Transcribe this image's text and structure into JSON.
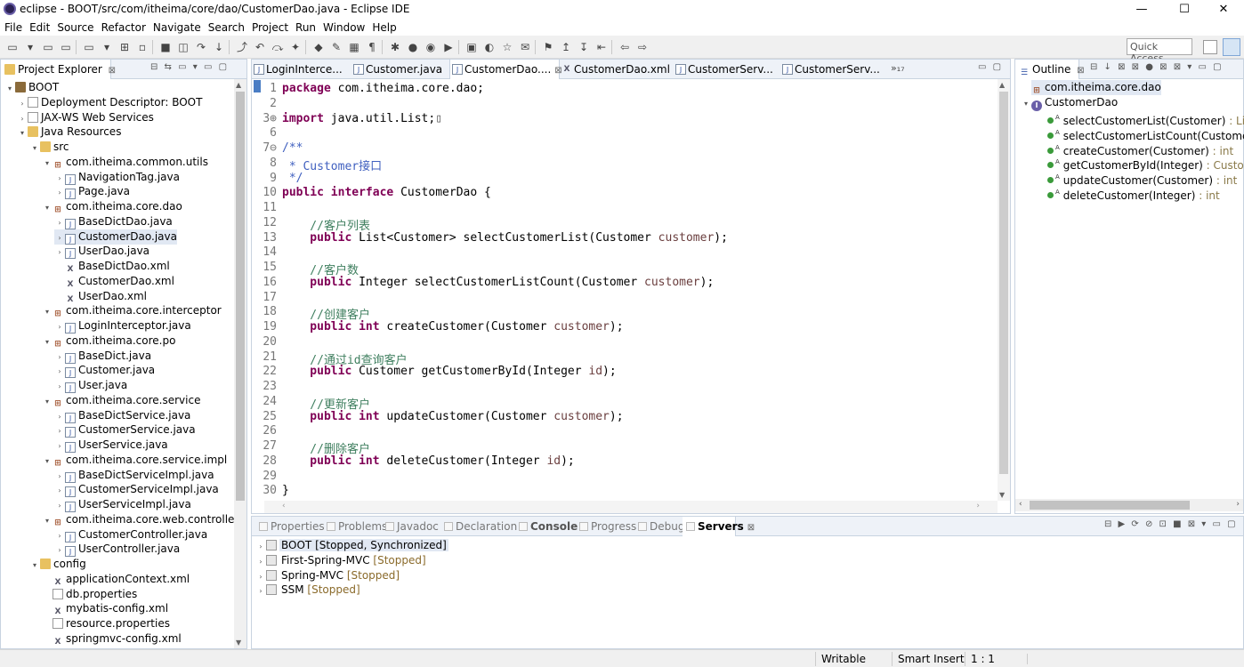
{
  "window": {
    "title": "eclipse - BOOT/src/com/itheima/core/dao/CustomerDao.java - Eclipse IDE",
    "minimize": "—",
    "maximize": "☐",
    "close": "✕"
  },
  "menu": [
    "File",
    "Edit",
    "Source",
    "Refactor",
    "Navigate",
    "Search",
    "Project",
    "Run",
    "Window",
    "Help"
  ],
  "quick_access": "Quick Access",
  "project_explorer": {
    "title": "Project Explorer",
    "close": "⊠",
    "tree": [
      {
        "label": "BOOT",
        "icon": "project-icon",
        "depth": 0,
        "tw": "▾"
      },
      {
        "label": "Deployment Descriptor: BOOT",
        "icon": "deployment-icon",
        "depth": 1,
        "tw": "›"
      },
      {
        "label": "JAX-WS Web Services",
        "icon": "webservice-icon",
        "depth": 1,
        "tw": "›"
      },
      {
        "label": "Java Resources",
        "icon": "java-resources-icon",
        "depth": 1,
        "tw": "▾"
      },
      {
        "label": "src",
        "icon": "source-folder-icon",
        "depth": 2,
        "tw": "▾"
      },
      {
        "label": "com.itheima.common.utils",
        "icon": "package-icon",
        "depth": 3,
        "tw": "▾"
      },
      {
        "label": "NavigationTag.java",
        "icon": "java-file-icon",
        "depth": 4,
        "tw": "›"
      },
      {
        "label": "Page.java",
        "icon": "java-file-icon",
        "depth": 4,
        "tw": "›"
      },
      {
        "label": "com.itheima.core.dao",
        "icon": "package-icon",
        "depth": 3,
        "tw": "▾"
      },
      {
        "label": "BaseDictDao.java",
        "icon": "java-file-icon",
        "depth": 4,
        "tw": "›"
      },
      {
        "label": "CustomerDao.java",
        "icon": "java-file-icon",
        "depth": 4,
        "tw": "›",
        "selected": true
      },
      {
        "label": "UserDao.java",
        "icon": "java-file-icon",
        "depth": 4,
        "tw": "›"
      },
      {
        "label": "BaseDictDao.xml",
        "icon": "xml-file-icon",
        "depth": 4,
        "tw": ""
      },
      {
        "label": "CustomerDao.xml",
        "icon": "xml-file-icon",
        "depth": 4,
        "tw": ""
      },
      {
        "label": "UserDao.xml",
        "icon": "xml-file-icon",
        "depth": 4,
        "tw": ""
      },
      {
        "label": "com.itheima.core.interceptor",
        "icon": "package-icon",
        "depth": 3,
        "tw": "▾"
      },
      {
        "label": "LoginInterceptor.java",
        "icon": "java-file-icon",
        "depth": 4,
        "tw": "›"
      },
      {
        "label": "com.itheima.core.po",
        "icon": "package-icon",
        "depth": 3,
        "tw": "▾"
      },
      {
        "label": "BaseDict.java",
        "icon": "java-file-icon",
        "depth": 4,
        "tw": "›"
      },
      {
        "label": "Customer.java",
        "icon": "java-file-icon",
        "depth": 4,
        "tw": "›"
      },
      {
        "label": "User.java",
        "icon": "java-file-icon",
        "depth": 4,
        "tw": "›"
      },
      {
        "label": "com.itheima.core.service",
        "icon": "package-icon",
        "depth": 3,
        "tw": "▾"
      },
      {
        "label": "BaseDictService.java",
        "icon": "java-file-icon",
        "depth": 4,
        "tw": "›"
      },
      {
        "label": "CustomerService.java",
        "icon": "java-file-icon",
        "depth": 4,
        "tw": "›"
      },
      {
        "label": "UserService.java",
        "icon": "java-file-icon",
        "depth": 4,
        "tw": "›"
      },
      {
        "label": "com.itheima.core.service.impl",
        "icon": "package-icon",
        "depth": 3,
        "tw": "▾"
      },
      {
        "label": "BaseDictServiceImpl.java",
        "icon": "java-file-icon",
        "depth": 4,
        "tw": "›"
      },
      {
        "label": "CustomerServiceImpl.java",
        "icon": "java-file-icon",
        "depth": 4,
        "tw": "›"
      },
      {
        "label": "UserServiceImpl.java",
        "icon": "java-file-icon",
        "depth": 4,
        "tw": "›"
      },
      {
        "label": "com.itheima.core.web.controller",
        "icon": "package-icon",
        "depth": 3,
        "tw": "▾"
      },
      {
        "label": "CustomerController.java",
        "icon": "java-file-icon",
        "depth": 4,
        "tw": "›"
      },
      {
        "label": "UserController.java",
        "icon": "java-file-icon",
        "depth": 4,
        "tw": "›"
      },
      {
        "label": "config",
        "icon": "folder-icon",
        "depth": 2,
        "tw": "▾"
      },
      {
        "label": "applicationContext.xml",
        "icon": "xml-file-icon",
        "depth": 3,
        "tw": ""
      },
      {
        "label": "db.properties",
        "icon": "properties-file-icon",
        "depth": 3,
        "tw": ""
      },
      {
        "label": "mybatis-config.xml",
        "icon": "xml-file-icon",
        "depth": 3,
        "tw": ""
      },
      {
        "label": "resource.properties",
        "icon": "properties-file-icon",
        "depth": 3,
        "tw": ""
      },
      {
        "label": "springmvc-config.xml",
        "icon": "xml-file-icon",
        "depth": 3,
        "tw": ""
      }
    ]
  },
  "editor": {
    "tabs": [
      {
        "label": "LoginInterce...",
        "icon": "java-file-icon"
      },
      {
        "label": "Customer.java",
        "icon": "java-file-icon"
      },
      {
        "label": "CustomerDao....",
        "icon": "java-file-icon",
        "active": true,
        "close": "⊠"
      },
      {
        "label": "CustomerDao.xml",
        "icon": "xml-file-icon"
      },
      {
        "label": "CustomerServ...",
        "icon": "java-file-icon"
      },
      {
        "label": "CustomerServ...",
        "icon": "java-file-icon"
      }
    ],
    "overflow": "»₁₇",
    "code_lines": [
      {
        "n": "1",
        "t": [
          [
            "kw",
            "package"
          ],
          [
            "",
            "com.itheima.core.dao;"
          ]
        ]
      },
      {
        "n": "2",
        "t": []
      },
      {
        "n": "3⊕",
        "t": [
          [
            "kw",
            "import"
          ],
          [
            "",
            "java.util.List;"
          ],
          [
            "box",
            "▯"
          ]
        ]
      },
      {
        "n": "6",
        "t": []
      },
      {
        "n": "7⊖",
        "t": [
          [
            "jd",
            "/**"
          ]
        ]
      },
      {
        "n": "8",
        "t": [
          [
            "jd",
            " * Customer接口"
          ]
        ]
      },
      {
        "n": "9",
        "t": [
          [
            "jd",
            " */"
          ]
        ]
      },
      {
        "n": "10",
        "t": [
          [
            "kw",
            "public"
          ],
          [
            "kw",
            "interface"
          ],
          [
            "",
            "CustomerDao {"
          ]
        ]
      },
      {
        "n": "11",
        "t": []
      },
      {
        "n": "12",
        "t": [
          [
            "cm",
            "    //客户列表"
          ]
        ]
      },
      {
        "n": "13",
        "t": [
          [
            "kw",
            "    public"
          ],
          [
            "",
            "List<Customer> selectCustomerList(Customer"
          ],
          [
            "pv",
            "customer"
          ],
          [
            "",
            ");"
          ]
        ]
      },
      {
        "n": "14",
        "t": []
      },
      {
        "n": "15",
        "t": [
          [
            "cm",
            "    //客户数"
          ]
        ]
      },
      {
        "n": "16",
        "t": [
          [
            "kw",
            "    public"
          ],
          [
            "",
            "Integer selectCustomerListCount(Customer"
          ],
          [
            "pv",
            "customer"
          ],
          [
            "",
            ");"
          ]
        ]
      },
      {
        "n": "17",
        "t": []
      },
      {
        "n": "18",
        "t": [
          [
            "cm",
            "    //创建客户"
          ]
        ]
      },
      {
        "n": "19",
        "t": [
          [
            "kw",
            "    public"
          ],
          [
            "kw",
            "int"
          ],
          [
            "",
            "createCustomer(Customer"
          ],
          [
            "pv",
            "customer"
          ],
          [
            "",
            ");"
          ]
        ]
      },
      {
        "n": "20",
        "t": []
      },
      {
        "n": "21",
        "t": [
          [
            "cm",
            "    //通过id查询客户"
          ]
        ]
      },
      {
        "n": "22",
        "t": [
          [
            "kw",
            "    public"
          ],
          [
            "",
            "Customer getCustomerById(Integer"
          ],
          [
            "pv",
            "id"
          ],
          [
            "",
            ");"
          ]
        ]
      },
      {
        "n": "23",
        "t": []
      },
      {
        "n": "24",
        "t": [
          [
            "cm",
            "    //更新客户"
          ]
        ]
      },
      {
        "n": "25",
        "t": [
          [
            "kw",
            "    public"
          ],
          [
            "kw",
            "int"
          ],
          [
            "",
            "updateCustomer(Customer"
          ],
          [
            "pv",
            "customer"
          ],
          [
            "",
            ");"
          ]
        ]
      },
      {
        "n": "26",
        "t": []
      },
      {
        "n": "27",
        "t": [
          [
            "cm",
            "    //删除客户"
          ]
        ]
      },
      {
        "n": "28",
        "t": [
          [
            "kw",
            "    public"
          ],
          [
            "kw",
            "int"
          ],
          [
            "",
            "deleteCustomer(Integer"
          ],
          [
            "pv",
            "id"
          ],
          [
            "",
            ");"
          ]
        ]
      },
      {
        "n": "29",
        "t": []
      },
      {
        "n": "30",
        "t": [
          [
            "",
            "}"
          ]
        ]
      }
    ]
  },
  "outline": {
    "title": "Outline",
    "close": "⊠",
    "package": "com.itheima.core.dao",
    "interface": "CustomerDao",
    "methods": [
      {
        "name": "selectCustomerList(Customer)",
        "ret": " : List<C"
      },
      {
        "name": "selectCustomerListCount(Customer)",
        "ret": " :"
      },
      {
        "name": "createCustomer(Customer)",
        "ret": " : int"
      },
      {
        "name": "getCustomerById(Integer)",
        "ret": " : Customer"
      },
      {
        "name": "updateCustomer(Customer)",
        "ret": " : int"
      },
      {
        "name": "deleteCustomer(Integer)",
        "ret": " : int"
      }
    ]
  },
  "bottom": {
    "tabs": [
      {
        "label": "Properties",
        "icon": "properties-icon"
      },
      {
        "label": "Problems",
        "icon": "problems-icon"
      },
      {
        "label": "Javadoc",
        "icon": "javadoc-icon"
      },
      {
        "label": "Declaration",
        "icon": "declaration-icon"
      },
      {
        "label": "Console",
        "icon": "console-icon"
      },
      {
        "label": "Progress",
        "icon": "progress-icon"
      },
      {
        "label": "Debug",
        "icon": "debug-icon"
      },
      {
        "label": "Servers",
        "icon": "servers-icon",
        "active": true,
        "close": "⊠"
      }
    ],
    "servers": [
      {
        "name": "BOOT",
        "state": "[Stopped, Synchronized]",
        "selected": true
      },
      {
        "name": "First-Spring-MVC",
        "state": "[Stopped]"
      },
      {
        "name": "Spring-MVC",
        "state": "[Stopped]"
      },
      {
        "name": "SSM",
        "state": "[Stopped]"
      }
    ]
  },
  "status": {
    "writable": "Writable",
    "insert_mode": "Smart Insert",
    "position": "1 : 1"
  }
}
